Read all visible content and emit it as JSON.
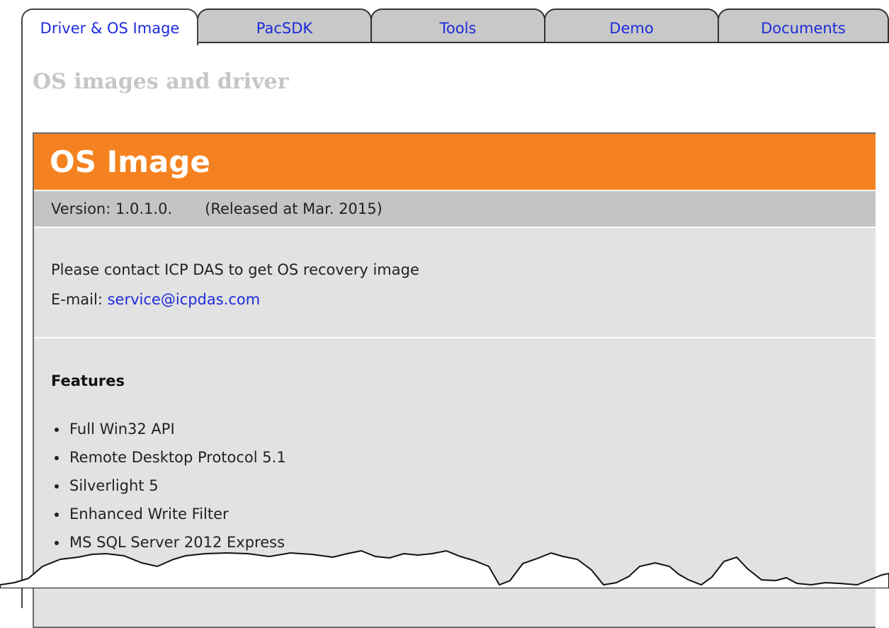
{
  "tabs": [
    {
      "label": "Driver & OS Image",
      "active": true
    },
    {
      "label": "PacSDK"
    },
    {
      "label": "Tools"
    },
    {
      "label": "Demo"
    },
    {
      "label": "Documents"
    }
  ],
  "section_title": "OS images and driver",
  "panel": {
    "title": "OS Image",
    "version": "Version: 1.0.1.0.",
    "released": "(Released at Mar. 2015)",
    "contact_line": "Please contact ICP DAS to get OS recovery image",
    "email_label": "E-mail:",
    "email": "service@icpdas.com",
    "features_heading": "Features",
    "features": [
      "Full Win32 API",
      "Remote Desktop Protocol 5.1",
      "Silverlight 5",
      "Enhanced Write Filter",
      "MS SQL Server 2012 Express"
    ]
  },
  "colors": {
    "accent_orange": "#f58220",
    "link_blue": "#1d2bd9",
    "tab_gray": "#c8c8c8",
    "panel_gray": "#e2e2e2",
    "version_gray": "#c4c4c4"
  }
}
